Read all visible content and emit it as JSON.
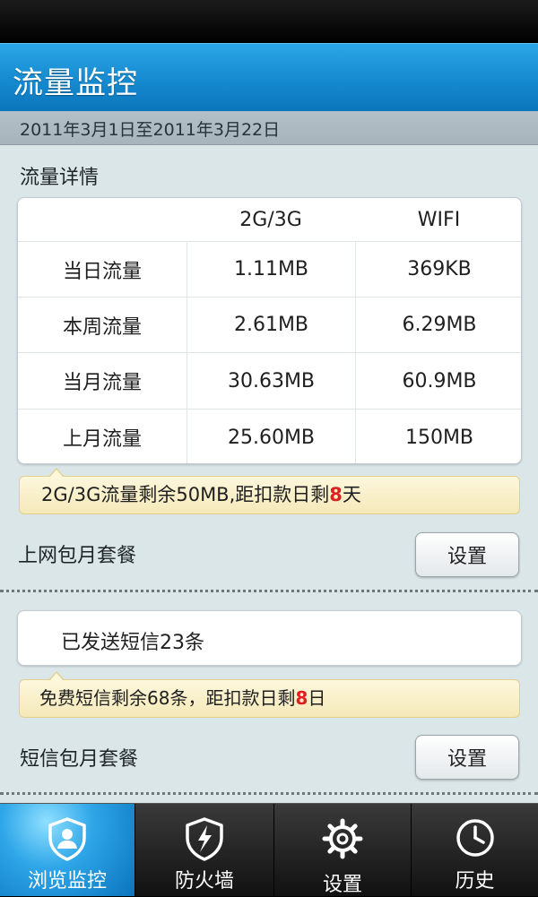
{
  "header": {
    "title": "流量监控"
  },
  "date_range": "2011年3月1日至2011年3月22日",
  "traffic": {
    "section_title": "流量详情",
    "columns": [
      "",
      "2G/3G",
      "WIFI"
    ],
    "rows": [
      {
        "label": "当日流量",
        "mobile": "1.11MB",
        "wifi": "369KB"
      },
      {
        "label": "本周流量",
        "mobile": "2.61MB",
        "wifi": "6.29MB"
      },
      {
        "label": "当月流量",
        "mobile": "30.63MB",
        "wifi": "60.9MB"
      },
      {
        "label": "上月流量",
        "mobile": "25.60MB",
        "wifi": "150MB"
      }
    ],
    "tip_prefix": "2G/3G流量剩余50MB,距扣款日剩",
    "tip_days": "8",
    "tip_suffix": "天"
  },
  "data_plan": {
    "label": "上网包月套餐",
    "button_label": "设置"
  },
  "sms": {
    "sent_text": "已发送短信23条",
    "tip_prefix": "免费短信剩余68条，距扣款日剩",
    "tip_days": "8",
    "tip_suffix": "日"
  },
  "sms_plan": {
    "label": "短信包月套餐",
    "button_label": "设置"
  },
  "tabs": [
    {
      "label": "浏览监控",
      "icon": "user-shield-icon",
      "active": true
    },
    {
      "label": "防火墙",
      "icon": "firewall-shield-icon",
      "active": false
    },
    {
      "label": "设置",
      "icon": "gear-icon",
      "active": false
    },
    {
      "label": "历史",
      "icon": "clock-icon",
      "active": false
    }
  ],
  "colors": {
    "header_blue": "#168ad0",
    "highlight_red": "#e02020",
    "tip_yellow": "#f5e9b9",
    "active_tab_blue": "#2ea6e8"
  }
}
